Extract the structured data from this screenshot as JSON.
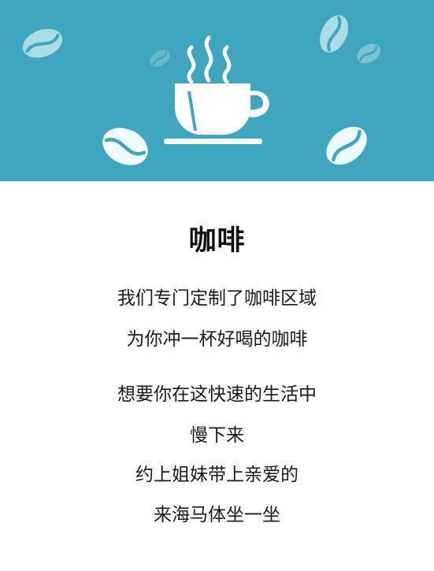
{
  "banner": {
    "background_color": "#40a5bf",
    "icons": [
      "coffee-cup-icon",
      "coffee-bean-icon"
    ]
  },
  "title": "咖啡",
  "lines": [
    "我们专门定制了咖啡区域",
    "为你冲一杯好喝的咖啡",
    "想要你在这快速的生活中",
    "慢下来",
    "约上姐妹带上亲爱的",
    "来海马体坐一坐"
  ]
}
